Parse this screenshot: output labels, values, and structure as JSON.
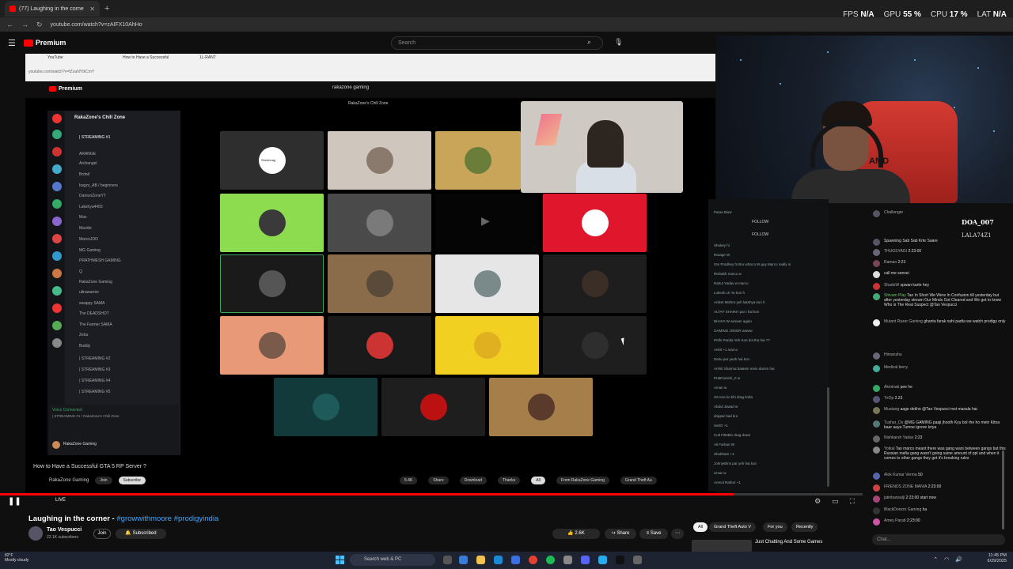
{
  "browser": {
    "tab_title": "(77) Laughing in the corne",
    "url": "youtube.com/watch?v=zAIFX10AhHo"
  },
  "stats": {
    "fps_label": "FPS",
    "fps_value": "N/A",
    "gpu_label": "GPU",
    "gpu_value": "55 %",
    "cpu_label": "CPU",
    "cpu_value": "17 %",
    "lat_label": "LAT",
    "lat_value": "N/A"
  },
  "yt_header": {
    "brand": "Premium",
    "search_placeholder": "Search"
  },
  "inner": {
    "tabs": [
      "YouTube",
      "How to Have a Successful",
      "1L-RANT"
    ],
    "url": "youtube.com/watch?v=fZuuNYtkCmY",
    "brand": "Premium",
    "search_value": "rakazone gaming",
    "channel_banner": "RakaZone's Chill Zone",
    "server_title": "RakaZone's Chill Zone",
    "channels": [
      "| STREAMING #1",
      "ARANGE",
      "Archangel",
      "Brdnd",
      "bugzz_AB / beginners",
      "DamonZoneYT",
      "Lakshya4455",
      "Max",
      "Mackle",
      "MarcoJOD",
      "MG Gaming",
      "PRATHMESH GAMING",
      "Q",
      "RakaZone Gaming",
      "ultrawarrior",
      "swappy SAMA",
      "The DEADSHOT",
      "The Farmer SAMA",
      "Zebu",
      "Buddy",
      "| STREAMING #2",
      "| STREAMING #3",
      "| STREAMING #4",
      "| STREAMING #5"
    ],
    "voice_status": "Voice Connected",
    "voice_channel": "| STREAMING #1 / RakaZone's Chill Zone",
    "user_name": "RakaZone Gaming",
    "video_title": "How to Have a Successful GTA 5 RP Server ?",
    "video_channel": "RakaZone Gaming",
    "join_label": "Join",
    "subscribe_label": "Subscribe",
    "like_count": "5.4K",
    "share_label": "Share",
    "download_label": "Download",
    "thanks_label": "Thanks",
    "chip_all": "All",
    "chip_from": "From RakaZone Gaming",
    "chip_gta": "Grand Theft Au",
    "tile_shesh": "Sheshnag"
  },
  "inner_chat": {
    "follow_1": "FOLLOW",
    "follow_2": "FOLLOW",
    "messages": [
      "Paras Bisw",
      "Shukey hi",
      "Rarage W",
      "Om Pradhey hi Bro what a W guy Marco really is",
      "Rishabh marco w",
      "Rahul Yadav w marco",
      "Lokesh Lk Ye kon h",
      "Aniket Mishra yeh lakshya kon h",
      "ALTAF SHAIKH par I hai kon",
      "BHAVA W answer again",
      "GAMING JOKER wwww",
      "Prithi Parida Yeh Kon bol tha hai ??",
      "Ankit +1 marco",
      "Deku par yeah hai kon",
      "Arshit Sharma baatein mein damm hai",
      "PratPamish_K w",
      "Aman w",
      "SS Kisi ko bhi drag krdia",
      "Abdul Jawad w",
      "drippar bad kro",
      "Se0O +1",
      "Cult FitNBin drag down",
      "Ali Farhan W",
      "Shubham +1",
      "JohnyWins par yeh hai kon",
      "Umar w",
      "Anmol Rathor +1"
    ]
  },
  "donation": {
    "doa": "DOA_007",
    "lala": "LALA74Z1"
  },
  "chat": {
    "messages": [
      {
        "name": "Challenger",
        "text": ""
      },
      {
        "name": "",
        "text": "Spawning Sab Sab Krte Saare"
      },
      {
        "name": "THUGSYAGI",
        "text": "2:23:00"
      },
      {
        "name": "Raman",
        "text": "2:23"
      },
      {
        "name": "",
        "text": "call me sensei"
      },
      {
        "name": "ShadoW",
        "text": "spwan karte hey"
      },
      {
        "name": "Shivam Play",
        "text": "Tao In Short We Were In Confusion till yesterday but after yesterday stream Our Minds Got Cleared and We got to know Who is The Real Suspect @Tao Vespucci"
      },
      {
        "name": "Mutant Razer Gaming",
        "text": "ghanta farak nahi padta we watch prodigy only"
      },
      {
        "name": "Himanshu",
        "text": ""
      },
      {
        "name": "Medical berry",
        "text": ""
      },
      {
        "name": "Akminati",
        "text": "pee he"
      },
      {
        "name": "TxOp",
        "text": "2.23"
      },
      {
        "name": "Mustang",
        "text": "aage dekho @Tao Vespucci mst masala hai"
      },
      {
        "name": "Tushar_Ds",
        "text": "@MG GAMING paaji jhooth Kyu bol rhe ho mein Kitna baar aaya Tumne ignore kriya"
      },
      {
        "name": "Nishkarsh Yadav",
        "text": "2:23"
      },
      {
        "name": "Yotkal",
        "text": "Tao marco meant there was gang wars between gangs but this Russian mafia gang wasn't going same amount of ppl and when it comes to other gangs they get it's breaking rules"
      },
      {
        "name": "Alok Kumar Verma",
        "text": "50"
      },
      {
        "name": "FRIENDS ZONE MANIA",
        "text": "2:23:00"
      },
      {
        "name": "jatinbansalji",
        "text": "2:23:00 start now"
      },
      {
        "name": "BlackDonzor Gaming",
        "text": "ha"
      },
      {
        "name": "Amey Parab",
        "text": "2:23:00"
      }
    ],
    "input_placeholder": "Chat..."
  },
  "video": {
    "title_text": "Laughing in the corner - ",
    "hashtags": "#growwithmoore #prodigyindia",
    "channel": "Tao Vespucci",
    "subscribers": "22.1K subscribers",
    "join_label": "Join",
    "subscribed_label": "Subscribed",
    "like_count": "2.6K",
    "share_label": "Share",
    "save_label": "Save",
    "live_label": "LIVE",
    "progress": 0.85
  },
  "recommendations": {
    "chips": [
      "All",
      "Grand Theft Auto V",
      "For you",
      "Recently"
    ],
    "first_title": "Just Chatting And Some Games"
  },
  "taskbar": {
    "weather_temp": "82°F",
    "weather_desc": "Mostly cloudy",
    "search_placeholder": "Search web & PC",
    "time": "11:45 PM",
    "date": "6/29/2025"
  },
  "colors": {
    "accent": "#ff0000",
    "link": "#3ea6ff",
    "chair": "#d43a32"
  }
}
